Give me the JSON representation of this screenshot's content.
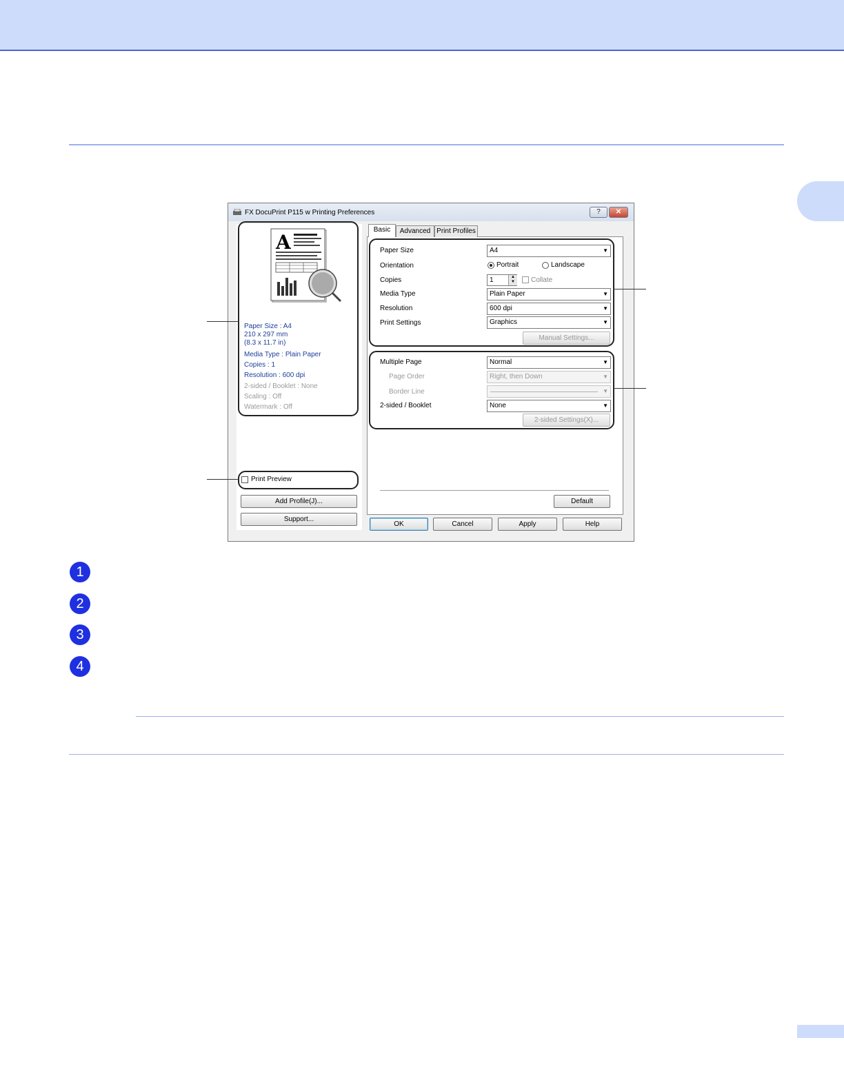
{
  "dialog": {
    "title": "FX DocuPrint P115 w Printing Preferences",
    "help_glyph": "?",
    "close_glyph": "✕",
    "summary": {
      "paper_size": "Paper Size : A4",
      "dims_mm": "210 x 297 mm",
      "dims_in": "(8.3 x 11.7 in)",
      "media_type": "Media Type : Plain Paper",
      "copies": "Copies : 1",
      "resolution": "Resolution : 600 dpi",
      "two_sided": "2-sided / Booklet : None",
      "scaling": "Scaling : Off",
      "watermark": "Watermark : Off"
    },
    "print_preview_label": "Print Preview",
    "add_profile_label": "Add Profile(J)...",
    "support_label": "Support...",
    "tabs": [
      "Basic",
      "Advanced",
      "Print Profiles"
    ],
    "paper_size": {
      "label": "Paper Size",
      "value": "A4"
    },
    "orientation": {
      "label": "Orientation",
      "portrait": "Portrait",
      "landscape": "Landscape",
      "selected": "Portrait"
    },
    "copies": {
      "label": "Copies",
      "value": "1",
      "collate": "Collate"
    },
    "media_type": {
      "label": "Media Type",
      "value": "Plain Paper"
    },
    "resolution": {
      "label": "Resolution",
      "value": "600 dpi"
    },
    "print_settings": {
      "label": "Print Settings",
      "value": "Graphics"
    },
    "manual_settings_label": "Manual Settings...",
    "multiple_page": {
      "label": "Multiple Page",
      "value": "Normal"
    },
    "page_order": {
      "label": "Page Order",
      "value": "Right, then Down"
    },
    "border_line": {
      "label": "Border Line"
    },
    "two_sided_booklet": {
      "label": "2-sided / Booklet",
      "value": "None"
    },
    "two_sided_settings_label": "2-sided Settings(X)...",
    "default_label": "Default",
    "ok_label": "OK",
    "cancel_label": "Cancel",
    "apply_label": "Apply",
    "help_label": "Help"
  },
  "preview_letter": "A",
  "callouts": [
    "1",
    "2",
    "3",
    "4"
  ],
  "colors": {
    "accent_band": "#cddcfa",
    "rule": "#9db0ec",
    "callout": "#1f30e0",
    "summary_text": "#1d3f99"
  }
}
